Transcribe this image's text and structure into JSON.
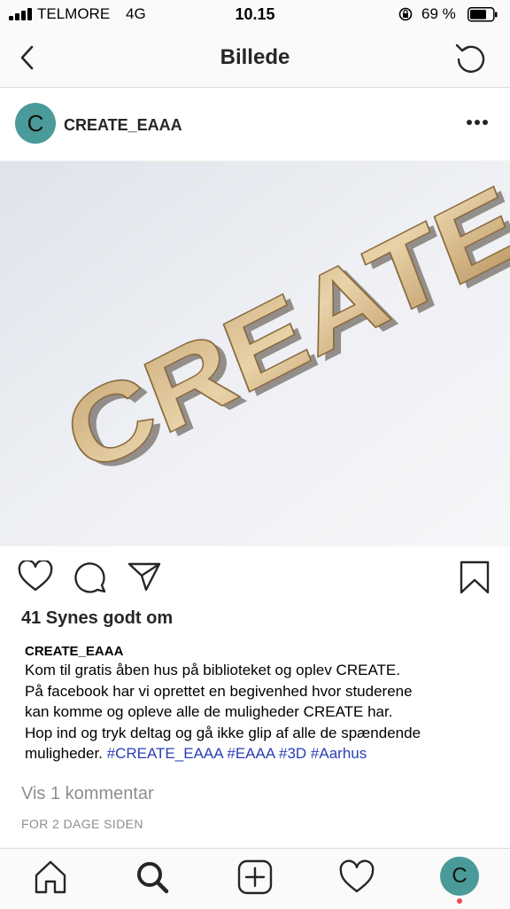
{
  "status_bar": {
    "carrier": "TELMORE",
    "network": "4G",
    "time": "10.15",
    "battery_percent": "69 %"
  },
  "header": {
    "title": "Billede",
    "back_icon": "chevron-left-icon",
    "refresh_icon": "refresh-icon"
  },
  "post": {
    "avatar_letter": "C",
    "username": "CREATE_EAAA",
    "more_icon": "more-horizontal-icon",
    "image_text": "CREATE",
    "likes": "41 Synes godt om",
    "caption_user": "CREATE_EAAA",
    "caption_lines": [
      "Kom til gratis åben hus på biblioteket og oplev CREATE.",
      "På facebook har vi oprettet en begivenhed hvor studerene",
      "kan komme og opleve alle de muligheder CREATE har.",
      "Hop ind og tryk deltag og gå ikke glip af alle de spændende",
      "muligheder."
    ],
    "hashtags": [
      "#CREATE_EAAA",
      "#EAAA",
      "#3D",
      "#Aarhus"
    ],
    "view_comments": "Vis 1 kommentar",
    "time_ago": "FOR 2 DAGE SIDEN"
  },
  "tabbar": {
    "items": [
      "home-icon",
      "search-icon",
      "new-post-icon",
      "activity-heart-icon",
      "profile-avatar"
    ],
    "avatar_letter": "C"
  },
  "colors": {
    "avatar_bg": "#4a9a9a",
    "hashtag": "#2a3fb5",
    "notification_dot": "#ed4956"
  }
}
